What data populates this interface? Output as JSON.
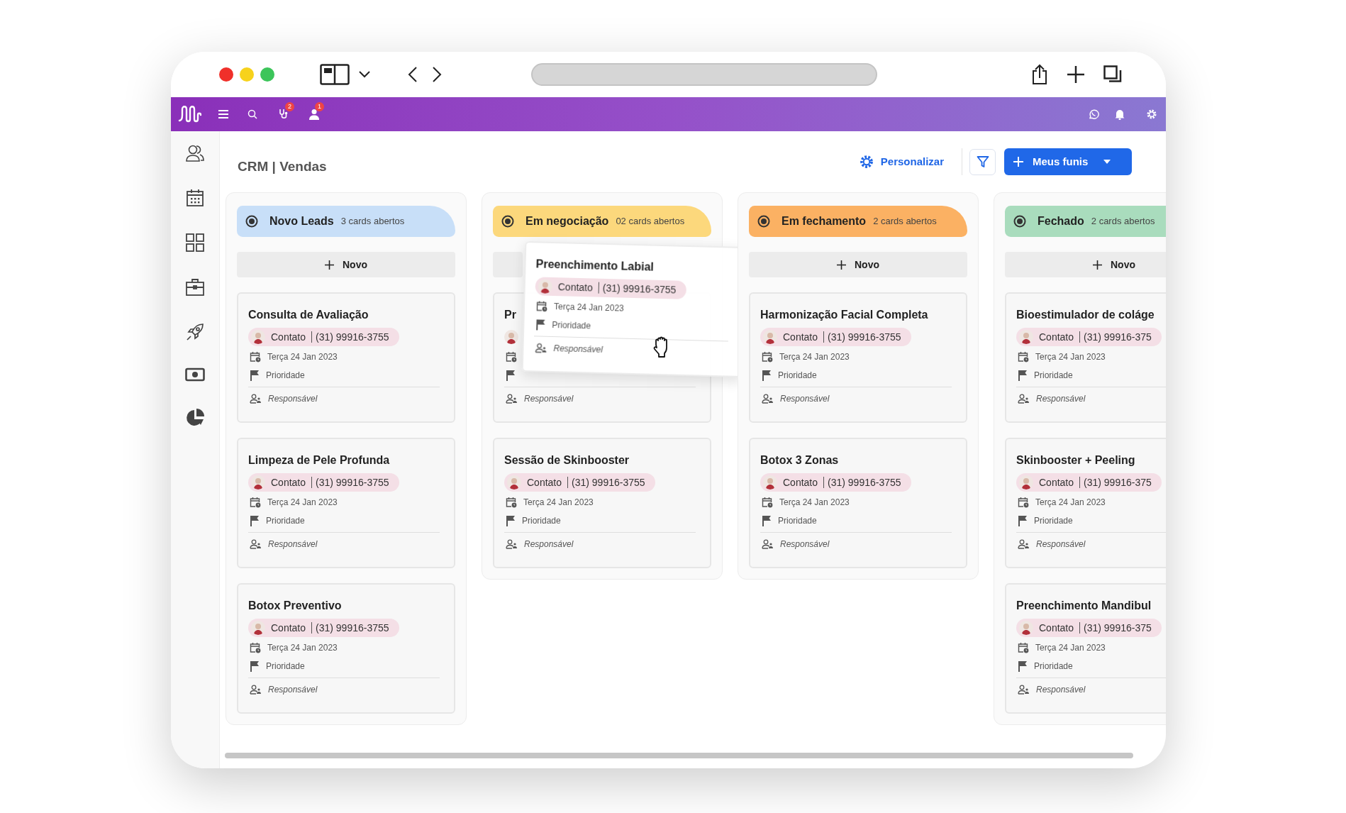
{
  "topbar": {
    "badges": [
      {
        "count": "2"
      },
      {
        "count": "1"
      }
    ]
  },
  "page": {
    "title": "CRM | Vendas"
  },
  "actions": {
    "customize": "Personalizar",
    "funnels": "Meus funis"
  },
  "columns": [
    {
      "name": "Novo Leads",
      "count": "3 cards abertos",
      "color": "#c8dff8",
      "add_label": "Novo",
      "cards": [
        {
          "title": "Consulta de Avaliação",
          "contact": "Contato",
          "phone": "(31) 99916-3755",
          "date": "Terça 24 Jan 2023",
          "priority": "Prioridade",
          "responsible": "Responsável"
        },
        {
          "title": "Limpeza de Pele Profunda",
          "contact": "Contato",
          "phone": "(31) 99916-3755",
          "date": "Terça 24 Jan 2023",
          "priority": "Prioridade",
          "responsible": "Responsável"
        },
        {
          "title": "Botox Preventivo",
          "contact": "Contato",
          "phone": "(31) 99916-3755",
          "date": "Terça 24 Jan 2023",
          "priority": "Prioridade",
          "responsible": "Responsável"
        }
      ]
    },
    {
      "name": "Em negociação",
      "count": "02 cards abertos",
      "color": "#fcd87c",
      "cards": [
        {
          "title": "Pr",
          "responsible": "Responsável"
        },
        {
          "title": "Sessão de Skinbooster",
          "contact": "Contato",
          "phone": "(31) 99916-3755",
          "date": "Terça 24 Jan 2023",
          "priority": "Prioridade",
          "responsible": "Responsável"
        }
      ]
    },
    {
      "name": "Em fechamento",
      "count": "2 cards abertos",
      "color": "#fbb163",
      "add_label": "Novo",
      "cards": [
        {
          "title": "Harmonização Facial Completa",
          "contact": "Contato",
          "phone": "(31) 99916-3755",
          "date": "Terça 24 Jan 2023",
          "priority": "Prioridade",
          "responsible": "Responsável"
        },
        {
          "title": "Botox 3 Zonas",
          "contact": "Contato",
          "phone": "(31) 99916-3755",
          "date": "Terça 24 Jan 2023",
          "priority": "Prioridade",
          "responsible": "Responsável"
        }
      ]
    },
    {
      "name": "Fechado",
      "count": "2 cards abertos",
      "color": "#a9dcbd",
      "add_label": "Novo",
      "cards": [
        {
          "title": "Bioestimulador de coláge",
          "contact": "Contato",
          "phone": "(31) 99916-375",
          "date": "Terça 24 Jan 2023",
          "priority": "Prioridade",
          "responsible": "Responsável"
        },
        {
          "title": "Skinbooster + Peeling",
          "contact": "Contato",
          "phone": "(31) 99916-375",
          "date": "Terça 24 Jan 2023",
          "priority": "Prioridade",
          "responsible": "Responsável"
        },
        {
          "title": "Preenchimento Mandibul",
          "contact": "Contato",
          "phone": "(31) 99916-375",
          "date": "Terça 24 Jan 2023",
          "priority": "Prioridade",
          "responsible": "Responsável"
        }
      ]
    }
  ],
  "drag_card": {
    "title": "Preenchimento Labial",
    "contact": "Contato",
    "phone": "(31) 99916-3755",
    "date": "Terça 24 Jan 2023",
    "priority": "Prioridade",
    "responsible": "Responsável"
  }
}
